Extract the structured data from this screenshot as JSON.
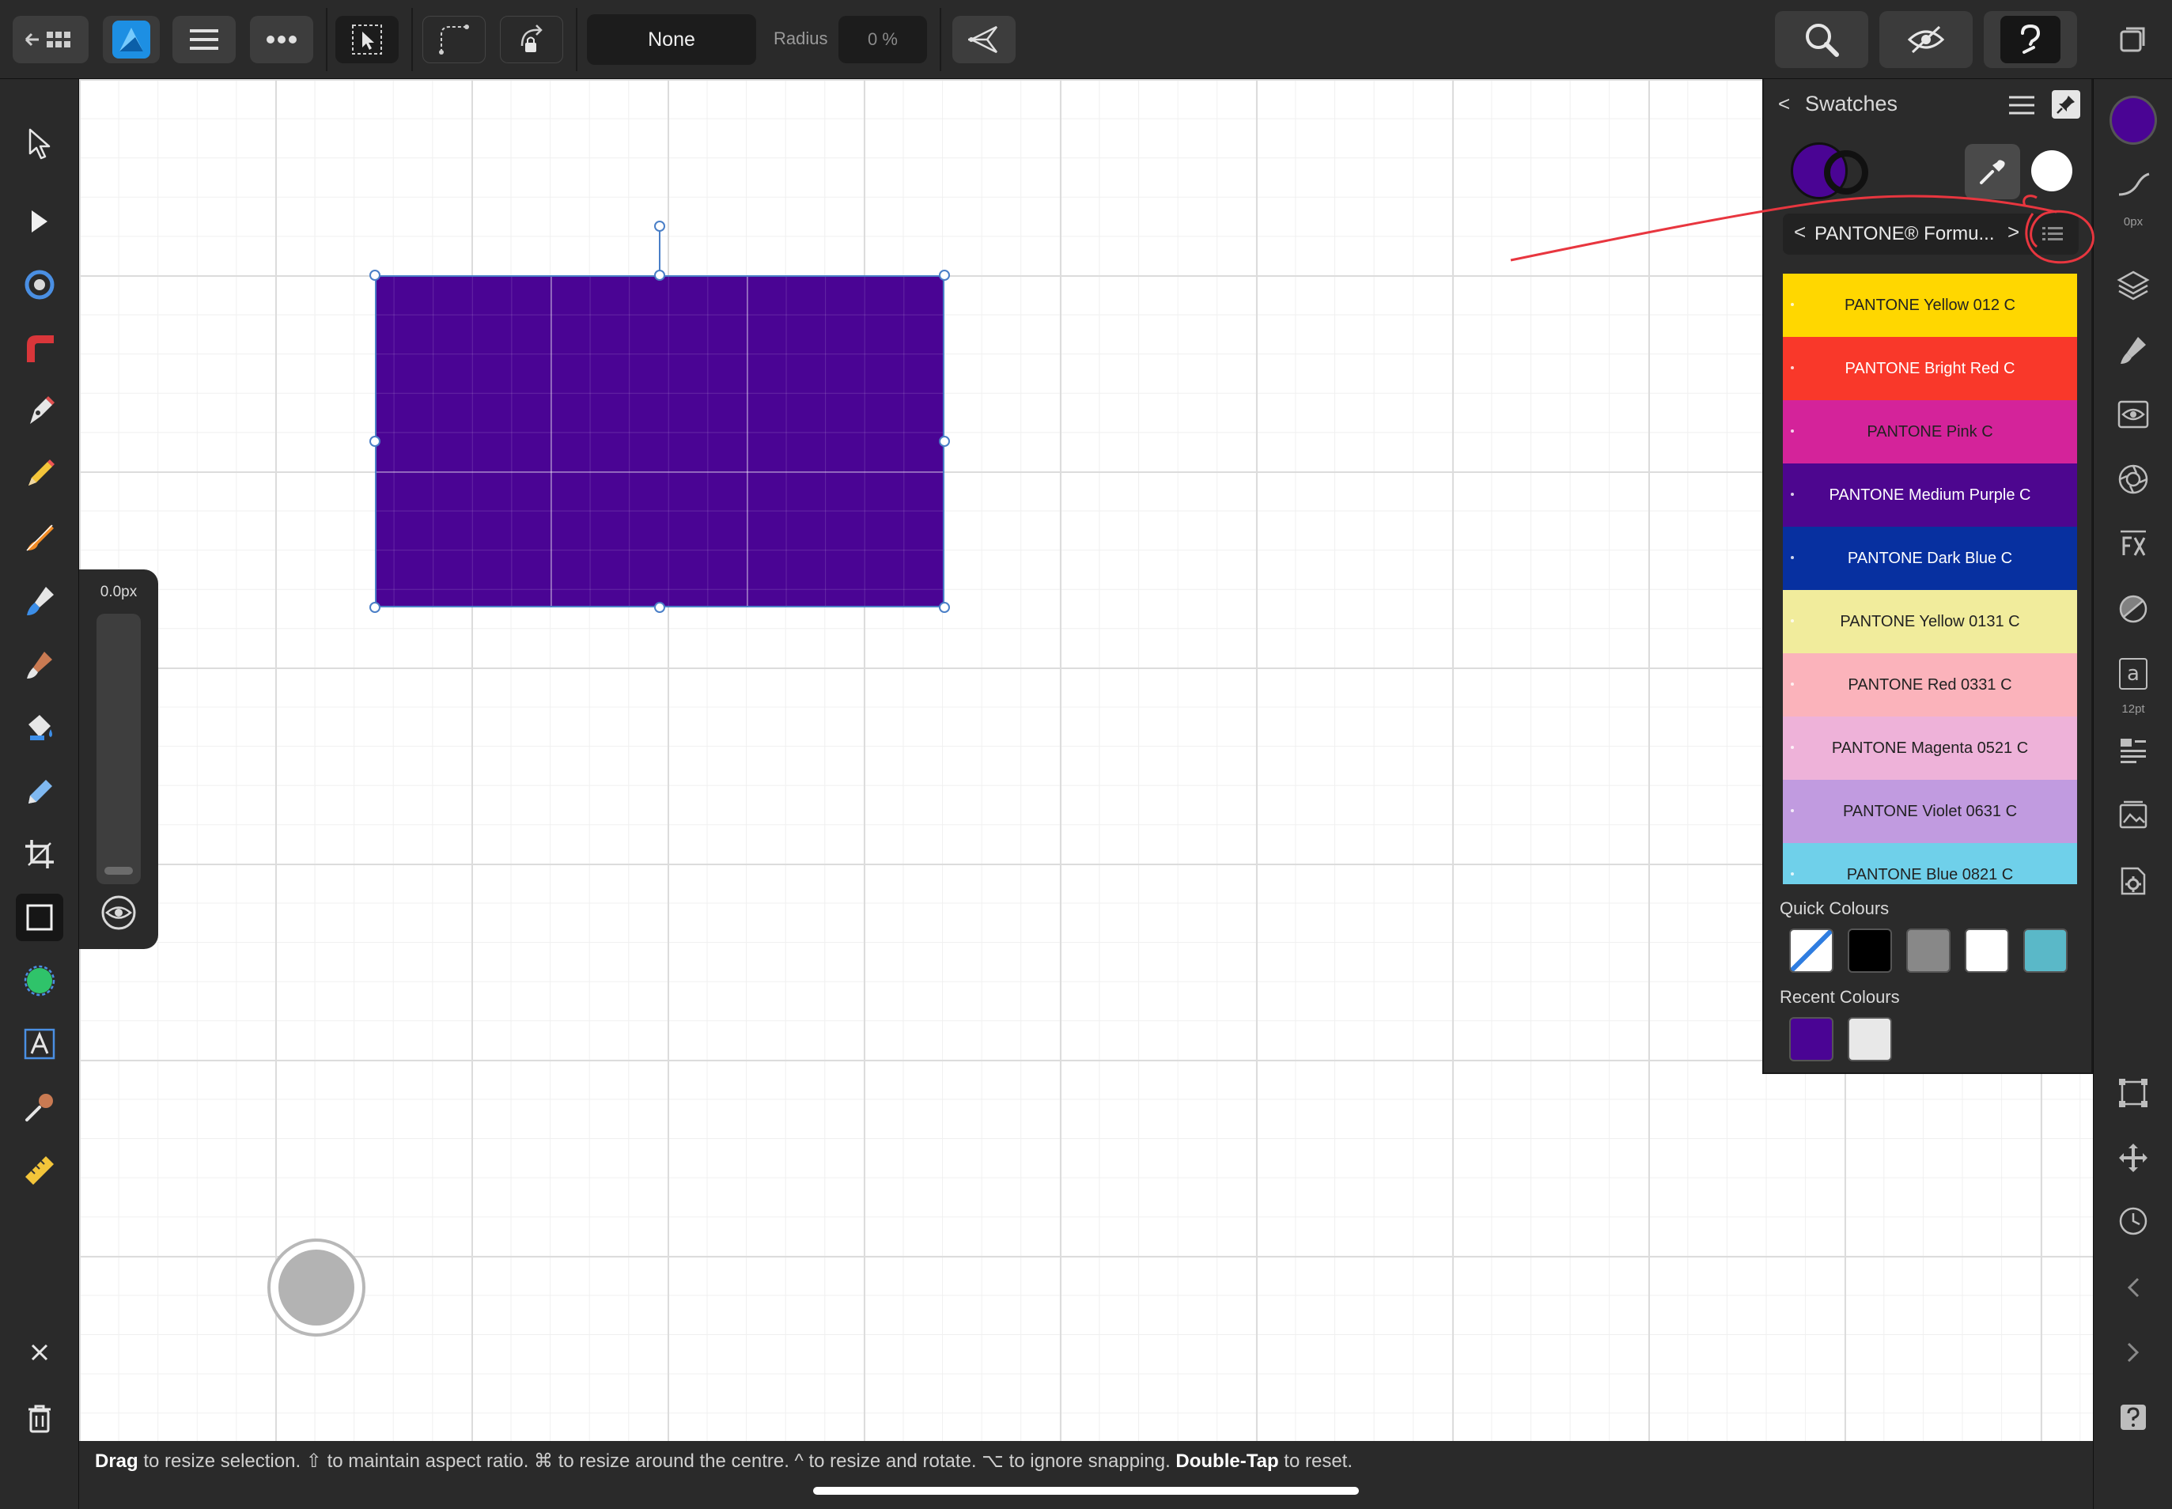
{
  "toolbar": {
    "mode_value": "None",
    "radius_label": "Radius",
    "radius_value": "0 %"
  },
  "width_popup": {
    "value": "0.0px"
  },
  "status_bar": {
    "parts": [
      {
        "text": "Drag",
        "bold": true
      },
      {
        "text": " to resize selection. ⇧ to maintain aspect ratio. ⌘ to resize around the centre. ^ to resize and rotate. ⌥ to ignore snapping. ",
        "bold": false
      },
      {
        "text": "Double-Tap",
        "bold": true
      },
      {
        "text": " to reset.",
        "bold": false
      }
    ]
  },
  "swatches": {
    "title": "Swatches",
    "back_glyph": "<",
    "fill_color": "#4a0494",
    "palette_prev": "<",
    "palette_name": "PANTONE® Formu...",
    "palette_next": ">",
    "items": [
      {
        "name": "PANTONE Yellow 012 C",
        "color": "#ffd700",
        "text_color": "#222222"
      },
      {
        "name": "PANTONE Bright Red C",
        "color": "#f9382a",
        "text_color": "#ffffff"
      },
      {
        "name": "PANTONE Pink C",
        "color": "#d4239a",
        "text_color": "#222222"
      },
      {
        "name": "PANTONE Medium Purple C",
        "color": "#4d068f",
        "text_color": "#ffffff"
      },
      {
        "name": "PANTONE Dark Blue C",
        "color": "#0730a0",
        "text_color": "#ffffff"
      },
      {
        "name": "PANTONE Yellow 0131 C",
        "color": "#f1ec9c",
        "text_color": "#222222"
      },
      {
        "name": "PANTONE Red 0331 C",
        "color": "#fbb3bb",
        "text_color": "#222222"
      },
      {
        "name": "PANTONE Magenta 0521 C",
        "color": "#eeb2d9",
        "text_color": "#222222"
      },
      {
        "name": "PANTONE Violet 0631 C",
        "color": "#c19be0",
        "text_color": "#222222"
      },
      {
        "name": "PANTONE Blue 0821 C",
        "color": "#6fd0ea",
        "text_color": "#222222"
      }
    ],
    "quick_label": "Quick Colours",
    "quick_colours": [
      "none",
      "#000000",
      "#888888",
      "#ffffff",
      "#5ab8c8"
    ],
    "recent_label": "Recent Colours",
    "recent_colours": [
      "#4a0494",
      "#e8e8e8"
    ]
  },
  "studio": {
    "top_color": "#4a0494",
    "stroke_caption": "0px",
    "text_caption": "12pt",
    "text_icon_glyph": "a"
  },
  "shape": {
    "fill": "#4a0494"
  }
}
